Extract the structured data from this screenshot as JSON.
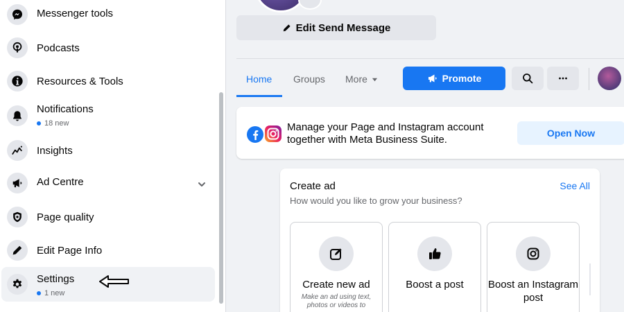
{
  "sidebar": {
    "items": [
      {
        "label": "Messenger tools",
        "icon": "messenger-icon"
      },
      {
        "label": "Podcasts",
        "icon": "podcast-icon"
      },
      {
        "label": "Resources & Tools",
        "icon": "info-icon"
      },
      {
        "label": "Notifications",
        "sub": "18 new",
        "icon": "bell-icon"
      },
      {
        "label": "Insights",
        "icon": "insights-icon"
      },
      {
        "label": "Ad Centre",
        "icon": "megaphone-icon",
        "expandable": true
      },
      {
        "label": "Page quality",
        "icon": "shield-icon"
      },
      {
        "label": "Edit Page Info",
        "icon": "pencil-icon"
      },
      {
        "label": "Settings",
        "sub": "1 new",
        "icon": "gear-icon",
        "active": true
      }
    ]
  },
  "main": {
    "edit_button": "Edit Send Message",
    "tabs": [
      {
        "label": "Home",
        "active": true
      },
      {
        "label": "Groups"
      },
      {
        "label": "More"
      }
    ],
    "promote_button": "Promote",
    "mbs_banner": {
      "text": "Manage your Page and Instagram account together with Meta Business Suite.",
      "button": "Open Now"
    },
    "create_ad": {
      "title": "Create ad",
      "subtitle": "How would you like to grow your business?",
      "see_all": "See All",
      "options": [
        {
          "label": "Create new ad",
          "desc": "Make an ad using text, photos or videos to",
          "icon": "edit-square-icon"
        },
        {
          "label": "Boost a post",
          "icon": "thumbs-up-icon"
        },
        {
          "label": "Boost an Instagram post",
          "icon": "instagram-icon"
        }
      ]
    }
  },
  "colors": {
    "accent": "#1877f2",
    "page_bg": "#f0f2f5",
    "card_bg": "#ffffff",
    "muted_text": "#65676b"
  }
}
